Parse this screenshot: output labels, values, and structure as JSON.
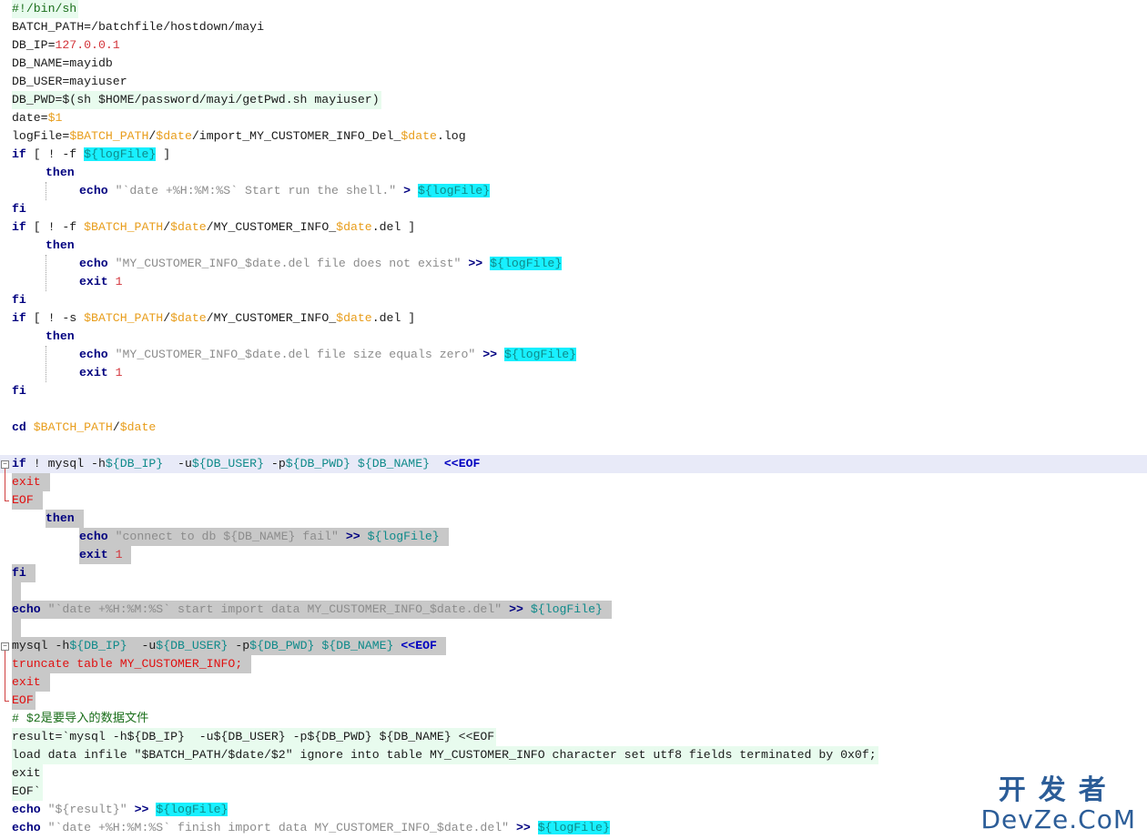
{
  "editor": {
    "lines": [
      {
        "bg": "bg-green",
        "indent": 0,
        "tokens": [
          [
            "comment",
            "#!/bin/sh"
          ]
        ]
      },
      {
        "bg": "",
        "indent": 0,
        "tokens": [
          [
            "plain",
            "BATCH_PATH=/batchfile/hostdown/mayi"
          ]
        ]
      },
      {
        "bg": "",
        "indent": 0,
        "tokens": [
          [
            "plain",
            "DB_IP="
          ],
          [
            "num",
            "127.0.0.1"
          ]
        ]
      },
      {
        "bg": "",
        "indent": 0,
        "tokens": [
          [
            "plain",
            "DB_NAME=mayidb"
          ]
        ]
      },
      {
        "bg": "",
        "indent": 0,
        "tokens": [
          [
            "plain",
            "DB_USER=mayiuser"
          ]
        ]
      },
      {
        "bg": "bg-green",
        "indent": 0,
        "tokens": [
          [
            "plain",
            "DB_PWD=$(sh $HOME/password/mayi/getPwd.sh mayiuser)"
          ]
        ]
      },
      {
        "bg": "",
        "indent": 0,
        "tokens": [
          [
            "plain",
            "date="
          ],
          [
            "var",
            "$1"
          ]
        ]
      },
      {
        "bg": "",
        "indent": 0,
        "tokens": [
          [
            "plain",
            "logFile="
          ],
          [
            "var",
            "$BATCH_PATH"
          ],
          [
            "plain",
            "/"
          ],
          [
            "var",
            "$date"
          ],
          [
            "plain",
            "/import_MY_CUSTOMER_INFO_Del_"
          ],
          [
            "var",
            "$date"
          ],
          [
            "plain",
            ".log"
          ]
        ]
      },
      {
        "bg": "",
        "indent": 0,
        "tokens": [
          [
            "kw",
            "if"
          ],
          [
            "plain",
            " [ ! -f "
          ],
          [
            "bvar-hl",
            "${logFile}"
          ],
          [
            "plain",
            " ]"
          ]
        ]
      },
      {
        "bg": "",
        "indent": 1,
        "tokens": [
          [
            "kw",
            "then"
          ]
        ]
      },
      {
        "bg": "",
        "indent": 2,
        "tokens": [
          [
            "kw",
            "echo"
          ],
          [
            "plain",
            " "
          ],
          [
            "str",
            "\"`date +%H:%M:%S` Start run the shell.\""
          ],
          [
            "plain",
            " "
          ],
          [
            "op",
            ">"
          ],
          [
            "plain",
            " "
          ],
          [
            "bvar-hl",
            "${logFile}"
          ]
        ]
      },
      {
        "bg": "",
        "indent": 0,
        "tokens": [
          [
            "kw",
            "fi"
          ]
        ]
      },
      {
        "bg": "",
        "indent": 0,
        "tokens": [
          [
            "kw",
            "if"
          ],
          [
            "plain",
            " [ ! -f "
          ],
          [
            "var",
            "$BATCH_PATH"
          ],
          [
            "plain",
            "/"
          ],
          [
            "var",
            "$date"
          ],
          [
            "plain",
            "/MY_CUSTOMER_INFO_"
          ],
          [
            "var",
            "$date"
          ],
          [
            "plain",
            ".del ]"
          ]
        ]
      },
      {
        "bg": "",
        "indent": 1,
        "tokens": [
          [
            "kw",
            "then"
          ]
        ]
      },
      {
        "bg": "",
        "indent": 2,
        "tokens": [
          [
            "kw",
            "echo"
          ],
          [
            "plain",
            " "
          ],
          [
            "str",
            "\"MY_CUSTOMER_INFO_$date.del file does not exist\""
          ],
          [
            "plain",
            " "
          ],
          [
            "op",
            ">>"
          ],
          [
            "plain",
            " "
          ],
          [
            "bvar-hl",
            "${logFile}"
          ]
        ]
      },
      {
        "bg": "",
        "indent": 2,
        "tokens": [
          [
            "kw",
            "exit"
          ],
          [
            "plain",
            " "
          ],
          [
            "num",
            "1"
          ]
        ]
      },
      {
        "bg": "",
        "indent": 0,
        "tokens": [
          [
            "kw",
            "fi"
          ]
        ]
      },
      {
        "bg": "",
        "indent": 0,
        "tokens": [
          [
            "kw",
            "if"
          ],
          [
            "plain",
            " [ ! -s "
          ],
          [
            "var",
            "$BATCH_PATH"
          ],
          [
            "plain",
            "/"
          ],
          [
            "var",
            "$date"
          ],
          [
            "plain",
            "/MY_CUSTOMER_INFO_"
          ],
          [
            "var",
            "$date"
          ],
          [
            "plain",
            ".del ]"
          ]
        ]
      },
      {
        "bg": "",
        "indent": 1,
        "tokens": [
          [
            "kw",
            "then"
          ]
        ]
      },
      {
        "bg": "",
        "indent": 2,
        "tokens": [
          [
            "kw",
            "echo"
          ],
          [
            "plain",
            " "
          ],
          [
            "str",
            "\"MY_CUSTOMER_INFO_$date.del file size equals zero\""
          ],
          [
            "plain",
            " "
          ],
          [
            "op",
            ">>"
          ],
          [
            "plain",
            " "
          ],
          [
            "bvar-hl",
            "${logFile}"
          ]
        ]
      },
      {
        "bg": "",
        "indent": 2,
        "tokens": [
          [
            "kw",
            "exit"
          ],
          [
            "plain",
            " "
          ],
          [
            "num",
            "1"
          ]
        ]
      },
      {
        "bg": "",
        "indent": 0,
        "tokens": [
          [
            "kw",
            "fi"
          ]
        ]
      },
      {
        "bg": "",
        "indent": 0,
        "tokens": []
      },
      {
        "bg": "",
        "indent": 0,
        "tokens": [
          [
            "kw",
            "cd"
          ],
          [
            "plain",
            " "
          ],
          [
            "var",
            "$BATCH_PATH"
          ],
          [
            "plain",
            "/"
          ],
          [
            "var",
            "$date"
          ]
        ]
      },
      {
        "bg": "",
        "indent": 0,
        "tokens": []
      },
      {
        "bg": "bg-blue",
        "indent": 0,
        "tokens": [
          [
            "kw",
            "if"
          ],
          [
            "plain",
            " ! mysql -h"
          ],
          [
            "bvar",
            "${DB_IP}"
          ],
          [
            "plain",
            "  -u"
          ],
          [
            "bvar",
            "${DB_USER}"
          ],
          [
            "plain",
            " -p"
          ],
          [
            "bvar",
            "${DB_PWD}"
          ],
          [
            "plain",
            " "
          ],
          [
            "bvar",
            "${DB_NAME}"
          ],
          [
            "plain",
            "  "
          ],
          [
            "eof",
            "<<EOF"
          ],
          [
            "plain",
            " "
          ]
        ]
      },
      {
        "bg": "bg-gray",
        "indent": 0,
        "tokens": [
          [
            "sqlred",
            "exit"
          ],
          [
            "plain",
            " "
          ]
        ]
      },
      {
        "bg": "bg-gray",
        "indent": 0,
        "tokens": [
          [
            "sqlred",
            "EOF"
          ],
          [
            "plain",
            " "
          ]
        ]
      },
      {
        "bg": "bg-gray",
        "indent": 1,
        "tokens": [
          [
            "kw",
            "then"
          ],
          [
            "plain",
            " "
          ]
        ]
      },
      {
        "bg": "bg-gray",
        "indent": 2,
        "tokens": [
          [
            "kw",
            "echo"
          ],
          [
            "plain",
            " "
          ],
          [
            "str",
            "\"connect to db ${DB_NAME} fail\""
          ],
          [
            "plain",
            " "
          ],
          [
            "op",
            ">>"
          ],
          [
            "plain",
            " "
          ],
          [
            "bvar",
            "${logFile}"
          ],
          [
            "plain",
            " "
          ]
        ]
      },
      {
        "bg": "bg-gray",
        "indent": 2,
        "tokens": [
          [
            "kw",
            "exit"
          ],
          [
            "plain",
            " "
          ],
          [
            "num",
            "1"
          ],
          [
            "plain",
            " "
          ]
        ]
      },
      {
        "bg": "bg-gray",
        "indent": 0,
        "tokens": [
          [
            "kw",
            "fi"
          ],
          [
            "plain",
            " "
          ]
        ]
      },
      {
        "bg": "bg-gray",
        "indent": 0,
        "tokens": [
          [
            "plain",
            " "
          ]
        ]
      },
      {
        "bg": "bg-gray",
        "indent": 0,
        "tokens": [
          [
            "kw",
            "echo"
          ],
          [
            "plain",
            " "
          ],
          [
            "str",
            "\"`date +%H:%M:%S` start import data MY_CUSTOMER_INFO_$date.del\""
          ],
          [
            "plain",
            " "
          ],
          [
            "op",
            ">>"
          ],
          [
            "plain",
            " "
          ],
          [
            "bvar",
            "${logFile}"
          ],
          [
            "plain",
            " "
          ]
        ]
      },
      {
        "bg": "bg-gray",
        "indent": 0,
        "tokens": [
          [
            "plain",
            " "
          ]
        ]
      },
      {
        "bg": "bg-gray",
        "indent": 0,
        "tokens": [
          [
            "plain",
            "mysql -h"
          ],
          [
            "bvar",
            "${DB_IP}"
          ],
          [
            "plain",
            "  -u"
          ],
          [
            "bvar",
            "${DB_USER}"
          ],
          [
            "plain",
            " -p"
          ],
          [
            "bvar",
            "${DB_PWD}"
          ],
          [
            "plain",
            " "
          ],
          [
            "bvar",
            "${DB_NAME}"
          ],
          [
            "plain",
            " "
          ],
          [
            "eof",
            "<<EOF"
          ],
          [
            "plain",
            " "
          ]
        ]
      },
      {
        "bg": "bg-gray",
        "indent": 0,
        "tokens": [
          [
            "sqlred",
            "truncate table MY_CUSTOMER_INFO;"
          ],
          [
            "plain",
            " "
          ]
        ]
      },
      {
        "bg": "bg-gray",
        "indent": 0,
        "tokens": [
          [
            "sqlred",
            "exit"
          ],
          [
            "plain",
            " "
          ]
        ]
      },
      {
        "bg": "bg-gray",
        "indent": 0,
        "tokens": [
          [
            "sqlred",
            "EOF"
          ]
        ]
      },
      {
        "bg": "",
        "indent": 0,
        "tokens": [
          [
            "comment",
            "# $2是要导入的数据文件"
          ]
        ]
      },
      {
        "bg": "bg-green",
        "indent": 0,
        "tokens": [
          [
            "plain",
            "result=`mysql -h${DB_IP}  -u${DB_USER} -p${DB_PWD} ${DB_NAME} <<EOF"
          ]
        ]
      },
      {
        "bg": "bg-green",
        "indent": 0,
        "tokens": [
          [
            "plain",
            "load data infile \"$BATCH_PATH/$date/$2\" ignore into table MY_CUSTOMER_INFO character set utf8 fields terminated by 0x0f;"
          ]
        ]
      },
      {
        "bg": "bg-green",
        "indent": 0,
        "tokens": [
          [
            "plain",
            "exit"
          ]
        ]
      },
      {
        "bg": "bg-green",
        "indent": 0,
        "tokens": [
          [
            "plain",
            "EOF`"
          ]
        ]
      },
      {
        "bg": "",
        "indent": 0,
        "tokens": [
          [
            "kw",
            "echo"
          ],
          [
            "plain",
            " "
          ],
          [
            "str",
            "\"${result}\""
          ],
          [
            "plain",
            " "
          ],
          [
            "op",
            ">>"
          ],
          [
            "plain",
            " "
          ],
          [
            "bvar-hl",
            "${logFile}"
          ]
        ]
      },
      {
        "bg": "",
        "indent": 0,
        "tokens": [
          [
            "kw",
            "echo"
          ],
          [
            "plain",
            " "
          ],
          [
            "str",
            "\"`date +%H:%M:%S` finish import data MY_CUSTOMER_INFO_$date.del\""
          ],
          [
            "plain",
            " "
          ],
          [
            "op",
            ">>"
          ],
          [
            "plain",
            " "
          ],
          [
            "bvar-hl",
            "${logFile}"
          ]
        ]
      }
    ]
  },
  "watermark": {
    "top": "开发者",
    "bottom": "DevZe.CoM"
  },
  "colors": {
    "keyword": "#00007f",
    "string": "#8c8c8c",
    "number": "#d3343a",
    "variable": "#e89d1b",
    "brace_variable": "#0f8a8a",
    "highlight": "#18f0ff",
    "watermark": "#2c5d98"
  }
}
